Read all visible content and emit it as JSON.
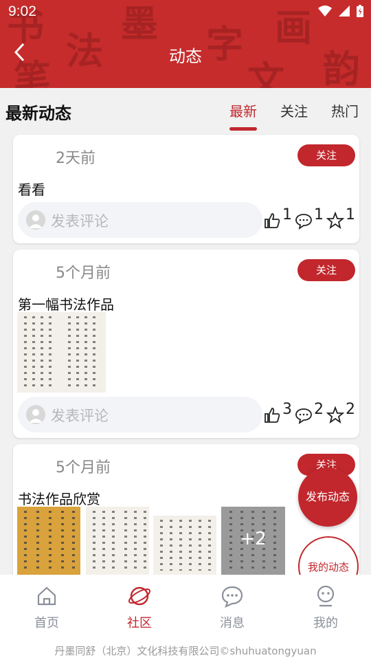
{
  "statusbar": {
    "time": "9:02"
  },
  "header": {
    "title": "动态"
  },
  "section": {
    "title": "最新动态"
  },
  "tabs": [
    {
      "label": "最新",
      "active": true
    },
    {
      "label": "关注",
      "active": false
    },
    {
      "label": "热门",
      "active": false
    }
  ],
  "posts": [
    {
      "time": "2天前",
      "follow_label": "关注",
      "text": "看看",
      "comment_placeholder": "发表评论",
      "likes": "1",
      "comments": "1",
      "favorites": "1"
    },
    {
      "time": "5个月前",
      "follow_label": "关注",
      "text": "第一幅书法作品",
      "comment_placeholder": "发表评论",
      "likes": "3",
      "comments": "2",
      "favorites": "2"
    },
    {
      "time": "5个月前",
      "follow_label": "关注",
      "text": "书法作品欣赏",
      "more_images": "+2"
    }
  ],
  "fab": {
    "post_label": "发布动态",
    "mine_label": "我的动态"
  },
  "nav": [
    {
      "label": "首页",
      "icon": "home-icon"
    },
    {
      "label": "社区",
      "icon": "planet-icon",
      "active": true
    },
    {
      "label": "消息",
      "icon": "message-icon"
    },
    {
      "label": "我的",
      "icon": "profile-icon"
    }
  ],
  "footer": {
    "text": "丹墨同舒（北京）文化科技有限公司©shuhuatongyuan"
  },
  "colors": {
    "brand": "#c1272d",
    "header": "#c62c2c",
    "background": "#f1f1f1"
  }
}
